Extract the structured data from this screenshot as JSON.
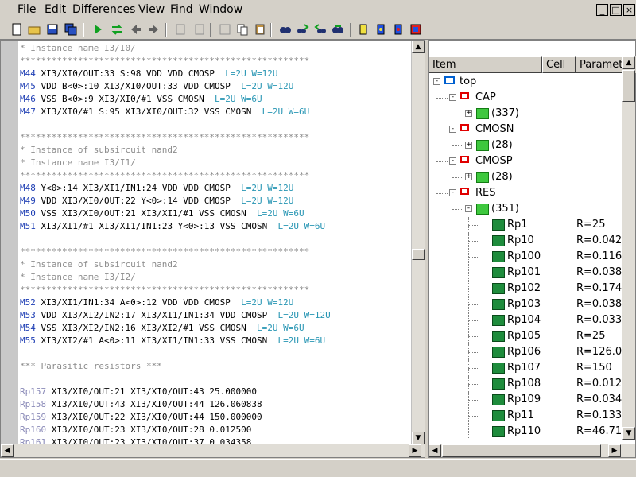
{
  "menu": [
    {
      "label": "File"
    },
    {
      "label": "Edit"
    },
    {
      "label": "Differences"
    },
    {
      "label": "View"
    },
    {
      "label": "Find"
    },
    {
      "label": "Window"
    }
  ],
  "window_controls": {
    "minimize": "_",
    "restore": "□",
    "close": "×"
  },
  "toolbar_icons": [
    "new-file-icon",
    "open-file-icon",
    "save-icon",
    "save-all-icon",
    "run-icon",
    "compare-icon",
    "back-arrow-icon",
    "forward-arrow-icon",
    "edit-icon",
    "edit-alt-icon",
    "cut-icon",
    "copy-icon",
    "paste-icon",
    "find-icon",
    "find-next-icon",
    "find-prev-icon",
    "find-all-icon",
    "device-icon",
    "device-alt-icon",
    "device-alt2-icon",
    "settings-icon"
  ],
  "code_lines": [
    {
      "cls": "comment",
      "text": "* Instance name I3/I0/"
    },
    {
      "cls": "comment",
      "text": "*******************************************************"
    },
    {
      "cls": "mos",
      "name": "M44",
      "body": " XI3/XI0/OUT:33 S:98 VDD VDD CMOSP  ",
      "param": "L=2U W=12U"
    },
    {
      "cls": "mos",
      "name": "M45",
      "body": " VDD B<0>:10 XI3/XI0/OUT:33 VDD CMOSP  ",
      "param": "L=2U W=12U"
    },
    {
      "cls": "mos",
      "name": "M46",
      "body": " VSS B<0>:9 XI3/XI0/#1 VSS CMOSN  ",
      "param": "L=2U W=6U"
    },
    {
      "cls": "mos",
      "name": "M47",
      "body": " XI3/XI0/#1 S:95 XI3/XI0/OUT:32 VSS CMOSN  ",
      "param": "L=2U W=6U"
    },
    {
      "cls": "blank",
      "text": ""
    },
    {
      "cls": "comment",
      "text": "*******************************************************"
    },
    {
      "cls": "comment",
      "text": "* Instance of subsircuit nand2"
    },
    {
      "cls": "comment",
      "text": "* Instance name I3/I1/"
    },
    {
      "cls": "comment",
      "text": "*******************************************************"
    },
    {
      "cls": "mos",
      "name": "M48",
      "body": " Y<0>:14 XI3/XI1/IN1:24 VDD VDD CMOSP  ",
      "param": "L=2U W=12U"
    },
    {
      "cls": "mos",
      "name": "M49",
      "body": " VDD XI3/XI0/OUT:22 Y<0>:14 VDD CMOSP  ",
      "param": "L=2U W=12U"
    },
    {
      "cls": "mos",
      "name": "M50",
      "body": " VSS XI3/XI0/OUT:21 XI3/XI1/#1 VSS CMOSN  ",
      "param": "L=2U W=6U"
    },
    {
      "cls": "mos",
      "name": "M51",
      "body": " XI3/XI1/#1 XI3/XI1/IN1:23 Y<0>:13 VSS CMOSN  ",
      "param": "L=2U W=6U"
    },
    {
      "cls": "blank",
      "text": ""
    },
    {
      "cls": "comment",
      "text": "*******************************************************"
    },
    {
      "cls": "comment",
      "text": "* Instance of subsircuit nand2"
    },
    {
      "cls": "comment",
      "text": "* Instance name I3/I2/"
    },
    {
      "cls": "comment",
      "text": "*******************************************************"
    },
    {
      "cls": "mos",
      "name": "M52",
      "body": " XI3/XI1/IN1:34 A<0>:12 VDD VDD CMOSP  ",
      "param": "L=2U W=12U"
    },
    {
      "cls": "mos",
      "name": "M53",
      "body": " VDD XI3/XI2/IN2:17 XI3/XI1/IN1:34 VDD CMOSP  ",
      "param": "L=2U W=12U"
    },
    {
      "cls": "mos",
      "name": "M54",
      "body": " VSS XI3/XI2/IN2:16 XI3/XI2/#1 VSS CMOSN  ",
      "param": "L=2U W=6U"
    },
    {
      "cls": "mos",
      "name": "M55",
      "body": " XI3/XI2/#1 A<0>:11 XI3/XI1/IN1:33 VSS CMOSN  ",
      "param": "L=2U W=6U"
    },
    {
      "cls": "blank",
      "text": ""
    },
    {
      "cls": "comment",
      "text": "*** Parasitic resistors ***"
    },
    {
      "cls": "blank",
      "text": ""
    },
    {
      "cls": "rp",
      "name": "Rp157",
      "body": " XI3/XI0/OUT:21 XI3/XI0/OUT:43 25.000000"
    },
    {
      "cls": "rp",
      "name": "Rp158",
      "body": " XI3/XI0/OUT:43 XI3/XI0/OUT:44 126.060838"
    },
    {
      "cls": "rp",
      "name": "Rp159",
      "body": " XI3/XI0/OUT:22 XI3/XI0/OUT:44 150.000000"
    },
    {
      "cls": "rp",
      "name": "Rp160",
      "body": " XI3/XI0/OUT:23 XI3/XI0/OUT:28 0.012500"
    },
    {
      "cls": "rp",
      "name": "Rp161",
      "body": " XI3/XI0/OUT:23 XI3/XI0/OUT:37 0.034358"
    }
  ],
  "tree_header": {
    "item": "Item",
    "cell": "Cell",
    "param": "Paramet"
  },
  "tree": [
    {
      "level": 0,
      "exp": "-",
      "icon": "top",
      "label": "top",
      "param": ""
    },
    {
      "level": 1,
      "exp": "-",
      "icon": "red",
      "label": "CAP",
      "param": ""
    },
    {
      "level": 2,
      "exp": "+",
      "icon": "green",
      "label": "(337)",
      "param": ""
    },
    {
      "level": 1,
      "exp": "-",
      "icon": "red",
      "label": "CMOSN",
      "param": ""
    },
    {
      "level": 2,
      "exp": "+",
      "icon": "green",
      "label": "(28)",
      "param": ""
    },
    {
      "level": 1,
      "exp": "-",
      "icon": "red",
      "label": "CMOSP",
      "param": ""
    },
    {
      "level": 2,
      "exp": "+",
      "icon": "green",
      "label": "(28)",
      "param": ""
    },
    {
      "level": 1,
      "exp": "-",
      "icon": "red",
      "label": "RES",
      "param": ""
    },
    {
      "level": 2,
      "exp": "-",
      "icon": "green",
      "label": "(351)",
      "param": ""
    },
    {
      "level": 3,
      "exp": "",
      "icon": "inst",
      "label": "Rp1",
      "param": "R=25"
    },
    {
      "level": 3,
      "exp": "",
      "icon": "inst",
      "label": "Rp10",
      "param": "R=0.042"
    },
    {
      "level": 3,
      "exp": "",
      "icon": "inst",
      "label": "Rp100",
      "param": "R=0.116"
    },
    {
      "level": 3,
      "exp": "",
      "icon": "inst",
      "label": "Rp101",
      "param": "R=0.038"
    },
    {
      "level": 3,
      "exp": "",
      "icon": "inst",
      "label": "Rp102",
      "param": "R=0.174"
    },
    {
      "level": 3,
      "exp": "",
      "icon": "inst",
      "label": "Rp103",
      "param": "R=0.038"
    },
    {
      "level": 3,
      "exp": "",
      "icon": "inst",
      "label": "Rp104",
      "param": "R=0.033"
    },
    {
      "level": 3,
      "exp": "",
      "icon": "inst",
      "label": "Rp105",
      "param": "R=25"
    },
    {
      "level": 3,
      "exp": "",
      "icon": "inst",
      "label": "Rp106",
      "param": "R=126.0"
    },
    {
      "level": 3,
      "exp": "",
      "icon": "inst",
      "label": "Rp107",
      "param": "R=150"
    },
    {
      "level": 3,
      "exp": "",
      "icon": "inst",
      "label": "Rp108",
      "param": "R=0.012"
    },
    {
      "level": 3,
      "exp": "",
      "icon": "inst",
      "label": "Rp109",
      "param": "R=0.034"
    },
    {
      "level": 3,
      "exp": "",
      "icon": "inst",
      "label": "Rp11",
      "param": "R=0.133"
    },
    {
      "level": 3,
      "exp": "",
      "icon": "inst",
      "label": "Rp110",
      "param": "R=46.71"
    }
  ],
  "scroll_arrows": {
    "up": "▲",
    "down": "▼",
    "left": "◀",
    "right": "▶"
  }
}
